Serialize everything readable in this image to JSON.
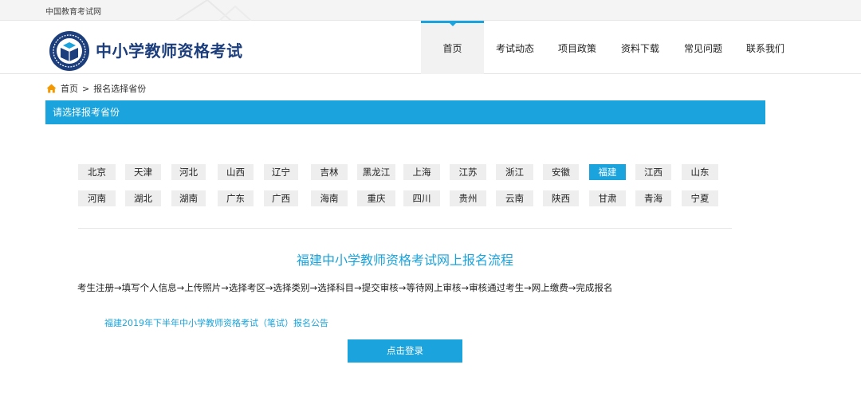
{
  "topbar": {
    "site_name": "中国教育考试网"
  },
  "header": {
    "brand": "中小学教师资格考试",
    "logo_icon": "book-emblem-icon"
  },
  "nav": {
    "items": [
      {
        "label": "首页",
        "active": true
      },
      {
        "label": "考试动态",
        "active": false
      },
      {
        "label": "项目政策",
        "active": false
      },
      {
        "label": "资料下载",
        "active": false
      },
      {
        "label": "常见问题",
        "active": false
      },
      {
        "label": "联系我们",
        "active": false
      }
    ]
  },
  "breadcrumb": {
    "home": "首页",
    "separator": ">",
    "current": "报名选择省份",
    "icon": "home-icon"
  },
  "section": {
    "title": "请选择报考省份"
  },
  "provinces": {
    "row1": [
      "北京",
      "天津",
      "河北",
      "山西",
      "辽宁",
      "吉林",
      "黑龙江",
      "上海",
      "江苏",
      "浙江",
      "安徽",
      "福建",
      "江西",
      "山东"
    ],
    "row2": [
      "河南",
      "湖北",
      "湖南",
      "广东",
      "广西",
      "海南",
      "重庆",
      "四川",
      "贵州",
      "云南",
      "陕西",
      "甘肃",
      "青海",
      "宁夏"
    ],
    "selected": "福建"
  },
  "flow": {
    "title": "福建中小学教师资格考试网上报名流程",
    "steps": "考生注册→填写个人信息→上传照片→选择考区→选择类别→选择科目→提交审核→等待网上审核→审核通过考生→网上缴费→完成报名"
  },
  "notice": {
    "link_text": "福建2019年下半年中小学教师资格考试（笔试）报名公告"
  },
  "login": {
    "button_label": "点击登录"
  },
  "colors": {
    "accent": "#1aa3dc",
    "brand_text": "#1d3e7c",
    "home_icon": "#f39800"
  }
}
